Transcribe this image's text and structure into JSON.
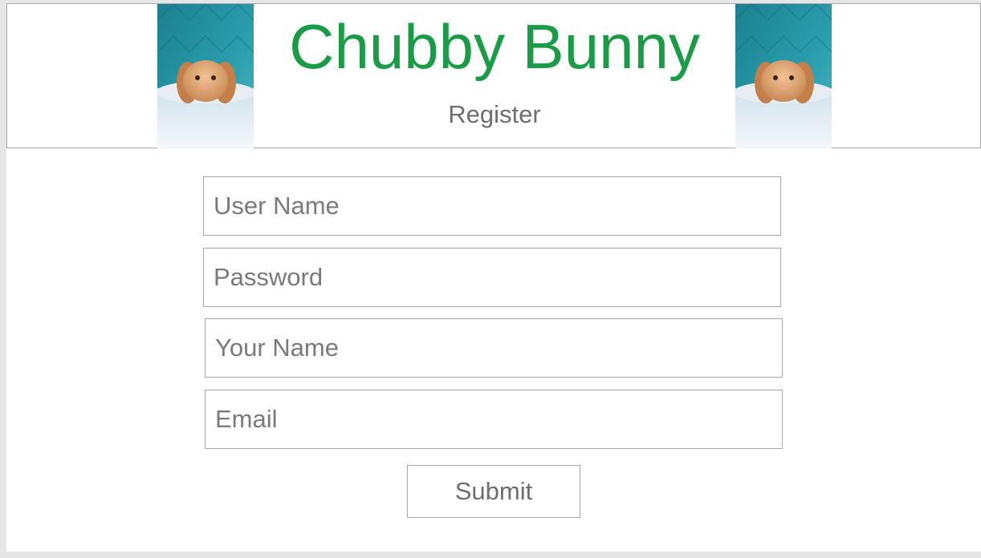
{
  "header": {
    "title": "Chubby Bunny",
    "subtitle": "Register"
  },
  "form": {
    "username": {
      "placeholder": "User Name",
      "value": ""
    },
    "password": {
      "placeholder": "Password",
      "value": ""
    },
    "your_name": {
      "placeholder": "Your Name",
      "value": ""
    },
    "email": {
      "placeholder": "Email",
      "value": ""
    },
    "submit_label": "Submit"
  },
  "colors": {
    "title": "#1a9b46",
    "muted_text": "#6e6e6e",
    "border": "#a9a9a9",
    "photo_backdrop": "#1f8fa0"
  },
  "icons": {
    "header_photo": "bunny-photo"
  }
}
